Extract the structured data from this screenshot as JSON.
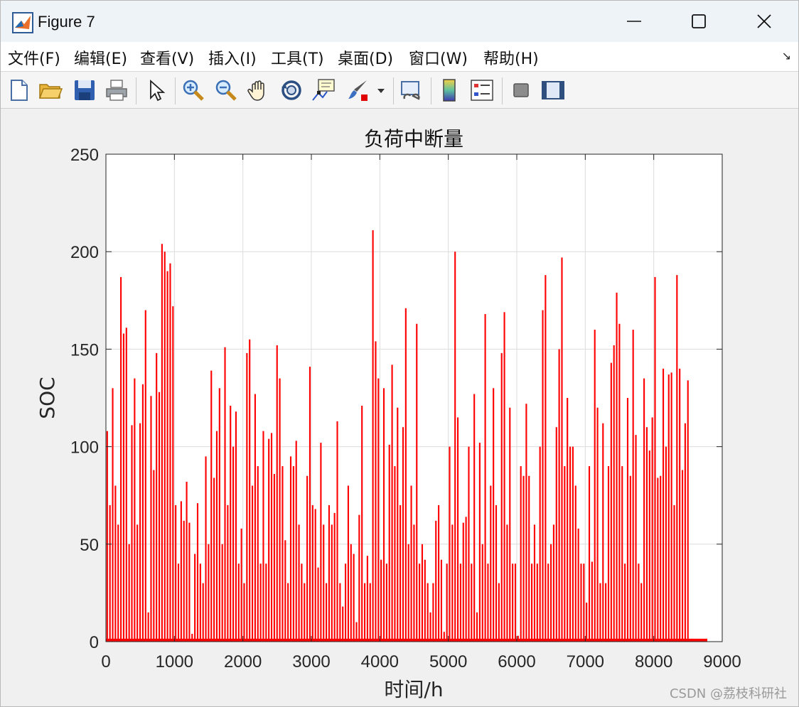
{
  "window": {
    "title": "Figure 7"
  },
  "menu": [
    "文件(F)",
    "编辑(E)",
    "查看(V)",
    "插入(I)",
    "工具(T)",
    "桌面(D)",
    "窗口(W)",
    "帮助(H)"
  ],
  "toolbar": [
    "new-figure",
    "open-file",
    "save",
    "print",
    "select-arrow",
    "zoom-in",
    "zoom-out",
    "pan",
    "rotate-3d",
    "data-cursor",
    "brush",
    "link-plot",
    "colorbar",
    "legend",
    "hide-plot-tools",
    "show-plot-tools"
  ],
  "watermark": "CSDN @荔枝科研社",
  "colors": {
    "series": "#ff0000",
    "grid": "#dcdcdc",
    "axes": "#262626"
  },
  "chart_data": {
    "type": "bar",
    "title": "负荷中断量",
    "xlabel": "时间/h",
    "ylabel": "SOC",
    "xlim": [
      0,
      9000
    ],
    "ylim": [
      0,
      250
    ],
    "xticks": [
      0,
      1000,
      2000,
      3000,
      4000,
      5000,
      6000,
      7000,
      8000,
      9000
    ],
    "yticks": [
      0,
      50,
      100,
      150,
      200,
      250
    ],
    "grid": true,
    "x": [
      0,
      40,
      80,
      120,
      160,
      200,
      240,
      280,
      320,
      360,
      400,
      440,
      480,
      520,
      560,
      600,
      640,
      680,
      720,
      760,
      800,
      840,
      880,
      920,
      960,
      1000,
      1040,
      1080,
      1120,
      1160,
      1200,
      1240,
      1280,
      1320,
      1360,
      1400,
      1440,
      1480,
      1520,
      1560,
      1600,
      1640,
      1680,
      1720,
      1760,
      1800,
      1840,
      1880,
      1920,
      1960,
      2000,
      2040,
      2080,
      2120,
      2160,
      2200,
      2240,
      2280,
      2320,
      2360,
      2400,
      2440,
      2480,
      2520,
      2560,
      2600,
      2640,
      2680,
      2720,
      2760,
      2800,
      2840,
      2880,
      2920,
      2960,
      3000,
      3040,
      3080,
      3120,
      3160,
      3200,
      3240,
      3280,
      3320,
      3360,
      3400,
      3440,
      3480,
      3520,
      3560,
      3600,
      3640,
      3680,
      3720,
      3760,
      3800,
      3840,
      3880,
      3920,
      3960,
      4000,
      4040,
      4080,
      4120,
      4160,
      4200,
      4240,
      4280,
      4320,
      4360,
      4400,
      4440,
      4480,
      4520,
      4560,
      4600,
      4640,
      4680,
      4720,
      4760,
      4800,
      4840,
      4880,
      4920,
      4960,
      5000,
      5040,
      5080,
      5120,
      5160,
      5200,
      5240,
      5280,
      5320,
      5360,
      5400,
      5440,
      5480,
      5520,
      5560,
      5600,
      5640,
      5680,
      5720,
      5760,
      5800,
      5840,
      5880,
      5920,
      5960,
      6000,
      6040,
      6080,
      6120,
      6160,
      6200,
      6240,
      6280,
      6320,
      6360,
      6400,
      6440,
      6480,
      6520,
      6560,
      6600,
      6640,
      6680,
      6720,
      6760,
      6800,
      6840,
      6880,
      6920,
      6960,
      7000,
      7040,
      7080,
      7120,
      7160,
      7200,
      7240,
      7280,
      7320,
      7360,
      7400,
      7440,
      7480,
      7520,
      7560,
      7600,
      7640,
      7680,
      7720,
      7760,
      7800,
      7840,
      7880,
      7920,
      7960,
      8000,
      8040,
      8080,
      8120,
      8160,
      8200,
      8240,
      8280,
      8320,
      8360,
      8400,
      8440,
      8480,
      8520,
      8560,
      8600,
      8640,
      8680,
      8720,
      8760
    ],
    "values": [
      108,
      70,
      130,
      80,
      60,
      187,
      158,
      161,
      50,
      111,
      135,
      60,
      112,
      132,
      170,
      15,
      126,
      88,
      148,
      128,
      204,
      200,
      190,
      194,
      172,
      70,
      40,
      72,
      62,
      82,
      61,
      4,
      45,
      71,
      40,
      30,
      95,
      50,
      139,
      84,
      108,
      130,
      50,
      151,
      70,
      121,
      100,
      118,
      40,
      58,
      30,
      148,
      155,
      80,
      127,
      90,
      40,
      108,
      40,
      104,
      107,
      86,
      152,
      135,
      90,
      52,
      30,
      95,
      90,
      103,
      60,
      40,
      30,
      85,
      141,
      70,
      68,
      38,
      102,
      60,
      30,
      70,
      60,
      66,
      113,
      30,
      18,
      40,
      80,
      50,
      45,
      10,
      65,
      121,
      30,
      44,
      30,
      211,
      154,
      135,
      42,
      130,
      40,
      101,
      142,
      90,
      120,
      70,
      110,
      171,
      50,
      80,
      60,
      163,
      40,
      50,
      42,
      30,
      15,
      30,
      62,
      70,
      42,
      5,
      40,
      100,
      60,
      200,
      115,
      40,
      61,
      64,
      100,
      40,
      127,
      15,
      102,
      50,
      168,
      40,
      80,
      130,
      70,
      30,
      148,
      169,
      60,
      120,
      40,
      40,
      3,
      90,
      85,
      122,
      85,
      40,
      60,
      40,
      100,
      170,
      188,
      40,
      50,
      60,
      110,
      150,
      197,
      90,
      125,
      100,
      100,
      80,
      58,
      40,
      40,
      20,
      90,
      41,
      160,
      120,
      30,
      112,
      30,
      90,
      143,
      152,
      179,
      163,
      90,
      40,
      125,
      85,
      160,
      106,
      40,
      30,
      135,
      110,
      98,
      115,
      187,
      84,
      85,
      140,
      100,
      137,
      138,
      70,
      188,
      140,
      88,
      112,
      134
    ]
  }
}
